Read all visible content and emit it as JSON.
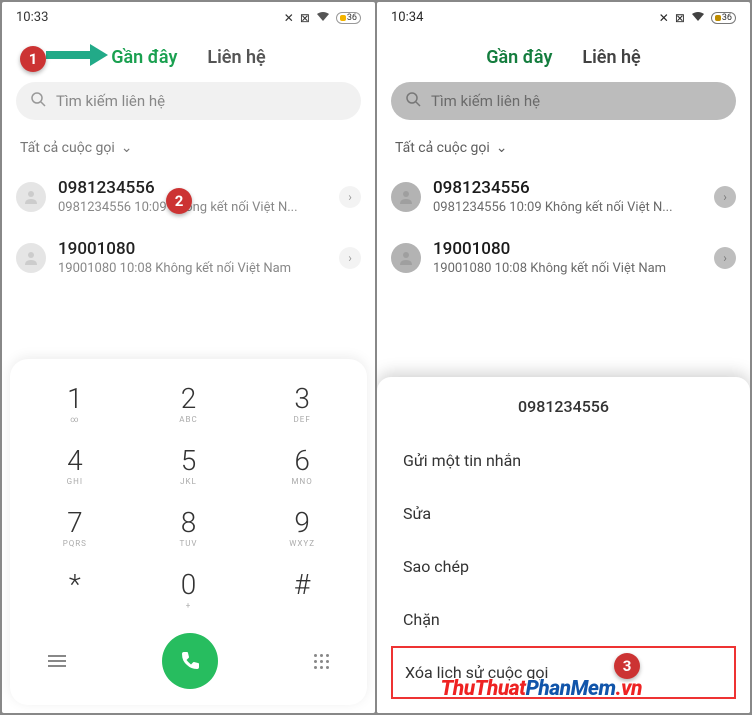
{
  "left": {
    "status": {
      "time": "10:33",
      "battery": "36"
    },
    "tabs": {
      "recent": "Gần đây",
      "contacts": "Liên hệ"
    },
    "search": {
      "placeholder": "Tìm kiếm liên hệ"
    },
    "filter": "Tất cả cuộc gọi",
    "calls": [
      {
        "number": "0981234556",
        "meta": "0981234556  10:09 Không kết nối  Việt N..."
      },
      {
        "number": "19001080",
        "meta": "19001080  10:08 Không kết nối  Việt Nam"
      }
    ],
    "dialpad": [
      {
        "n": "1",
        "l": "∞"
      },
      {
        "n": "2",
        "l": "ABC"
      },
      {
        "n": "3",
        "l": "DEF"
      },
      {
        "n": "4",
        "l": "GHI"
      },
      {
        "n": "5",
        "l": "JKL"
      },
      {
        "n": "6",
        "l": "MNO"
      },
      {
        "n": "7",
        "l": "PQRS"
      },
      {
        "n": "8",
        "l": "TUV"
      },
      {
        "n": "9",
        "l": "WXYZ"
      },
      {
        "n": "*",
        "l": ""
      },
      {
        "n": "0",
        "l": "+"
      },
      {
        "n": "#",
        "l": ""
      }
    ]
  },
  "right": {
    "status": {
      "time": "10:34",
      "battery": "36"
    },
    "tabs": {
      "recent": "Gần đây",
      "contacts": "Liên hệ"
    },
    "search": {
      "placeholder": "Tìm kiếm liên hệ"
    },
    "filter": "Tất cả cuộc gọi",
    "calls": [
      {
        "number": "0981234556",
        "meta": "0981234556  10:09 Không kết nối  Việt N..."
      },
      {
        "number": "19001080",
        "meta": "19001080  10:08 Không kết nối  Việt Nam"
      }
    ],
    "sheet": {
      "title": "0981234556",
      "items": [
        "Gửi một tin nhắn",
        "Sửa",
        "Sao chép",
        "Chặn",
        "Xóa lịch sử cuộc gọi"
      ]
    }
  },
  "badges": {
    "b1": "1",
    "b2": "2",
    "b3": "3"
  },
  "watermark": {
    "part1": "ThuThuat",
    "part2": "PhanMem",
    "part3": ".vn"
  }
}
